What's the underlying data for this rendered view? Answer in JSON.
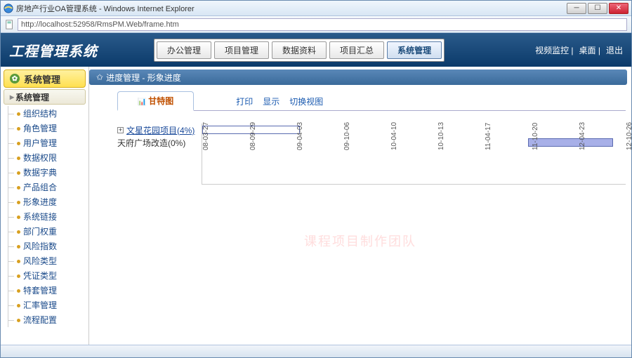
{
  "window": {
    "title": "房地产行业OA管理系统 - Windows Internet Explorer",
    "url": "http://localhost:52958/RmsPM.Web/frame.htm"
  },
  "app": {
    "logo": "工程管理系统",
    "nav": [
      "办公管理",
      "项目管理",
      "数据资料",
      "项目汇总",
      "系统管理"
    ],
    "nav_active": 4,
    "header_links": [
      "视频监控",
      "桌面",
      "退出"
    ]
  },
  "sidebar": {
    "header": "系统管理",
    "subheader": "系统管理",
    "items": [
      "组织结构",
      "角色管理",
      "用户管理",
      "数据权限",
      "数据字典",
      "产品组合",
      "形象进度",
      "系统链接",
      "部门权重",
      "风险指数",
      "风险类型",
      "凭证类型",
      "特套管理",
      "汇率管理",
      "流程配置"
    ]
  },
  "breadcrumb": "进度管理 - 形象进度",
  "gantt_tab": "甘特图",
  "actions": [
    "打印",
    "显示",
    "切换视图"
  ],
  "chart_data": {
    "type": "bar",
    "orientation": "horizontal-gantt",
    "rows": [
      {
        "label": "文星花园项目",
        "pct": "4%",
        "expandable": true,
        "link": true,
        "bar_start_pct": 0,
        "bar_width_pct": 23,
        "style": "outline"
      },
      {
        "label": "天府广场改造",
        "pct": "0%",
        "expandable": false,
        "link": false,
        "bar_start_pct": 77,
        "bar_width_pct": 20,
        "style": "fill"
      }
    ],
    "xticks": [
      "08-03-27",
      "08-09-29",
      "09-04-03",
      "09-10-06",
      "10-04-10",
      "10-10-13",
      "11-04-17",
      "11-10-20",
      "12-04-23",
      "12-10-26"
    ]
  },
  "watermark": "课程项目制作团队"
}
